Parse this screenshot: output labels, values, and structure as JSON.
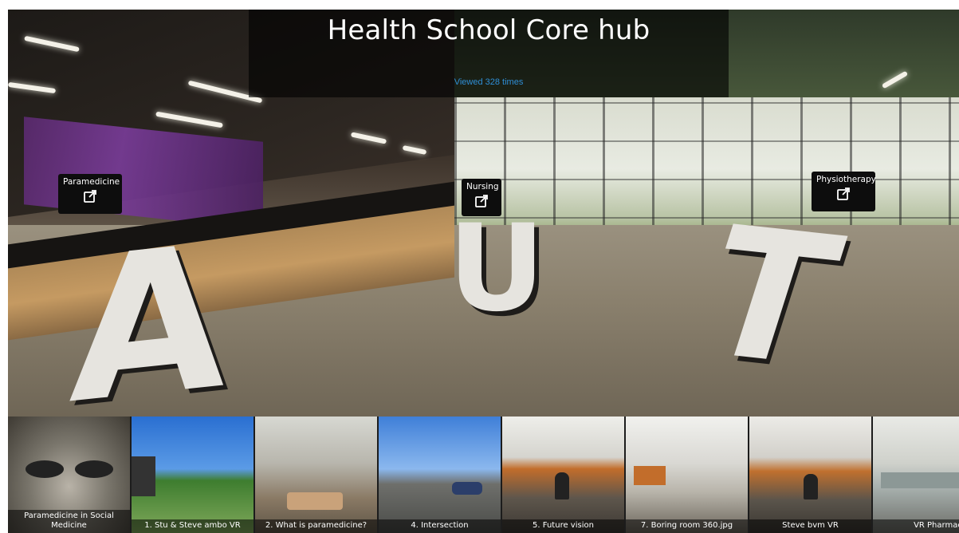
{
  "tour": {
    "title": "Health School Core hub",
    "views": "Viewed 328 times"
  },
  "scene": {
    "letters": [
      "A",
      "U",
      "T"
    ]
  },
  "hotspots": [
    {
      "label": "Paramedicine",
      "icon": "external-link-icon"
    },
    {
      "label": "Nursing",
      "icon": "external-link-icon"
    },
    {
      "label": "Physiotherapy",
      "icon": "external-link-icon"
    }
  ],
  "thumbnails": [
    {
      "caption": "Paramedicine in Social Medicine"
    },
    {
      "caption": "1. Stu & Steve ambo VR"
    },
    {
      "caption": "2. What is paramedicine?"
    },
    {
      "caption": "4. Intersection"
    },
    {
      "caption": "5. Future vision"
    },
    {
      "caption": "7. Boring room 360.jpg"
    },
    {
      "caption": "Steve bvm VR"
    },
    {
      "caption": "VR Pharmacology.jp"
    }
  ],
  "colors": {
    "views_link": "#2f8fd6",
    "hotspot_bg": "#0d0d0d",
    "title_bar_bg": "rgba(0,0,0,0.62)"
  }
}
